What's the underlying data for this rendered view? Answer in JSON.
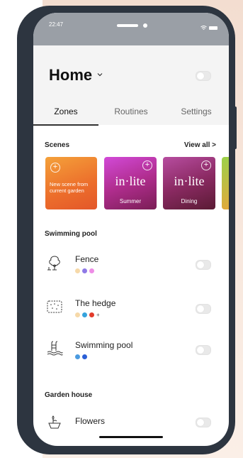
{
  "status": {
    "time": "22:47"
  },
  "header": {
    "title": "Home"
  },
  "tabs": [
    {
      "label": "Zones",
      "active": true
    },
    {
      "label": "Routines",
      "active": false
    },
    {
      "label": "Settings",
      "active": false
    }
  ],
  "scenes": {
    "heading": "Scenes",
    "view_all": "View all >",
    "items": [
      {
        "caption": "New scene from current garden",
        "type": "new"
      },
      {
        "brand": "in·lite",
        "caption": "Summer"
      },
      {
        "brand": "in·lite",
        "caption": "Dining"
      }
    ]
  },
  "sections": [
    {
      "heading": "Swimming pool",
      "zones": [
        {
          "name": "Fence",
          "icon": "tree-icon",
          "dots": [
            "#f6d9a9",
            "#8e79e6",
            "#ee8de6"
          ]
        },
        {
          "name": "The hedge",
          "icon": "hedge-icon",
          "dots": [
            "#f6d9a9",
            "#36a3dd",
            "#e33b2b"
          ],
          "extra": "+"
        },
        {
          "name": "Swimming pool",
          "icon": "pool-ladder-icon",
          "dots": [
            "#4b9be0",
            "#2b5fd6"
          ]
        }
      ]
    },
    {
      "heading": "Garden house",
      "zones": [
        {
          "name": "Flowers",
          "icon": "flowers-icon",
          "dots": []
        }
      ]
    }
  ]
}
